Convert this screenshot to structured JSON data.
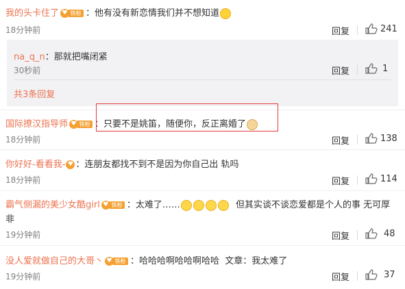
{
  "comments": [
    {
      "author": "我的头卡住了",
      "badge": "铁粉",
      "text": "：他有没有新恋情我们并不想知道",
      "emoji": "smiling-face-emoji",
      "time": "18分钟前",
      "reply_label": "回复",
      "likes": "241"
    },
    {
      "author": "国际撩汉指导师",
      "badge": "铁粉",
      "text": "：只要不是姚笛，随便你，反正离婚了",
      "emoji": "dog-face-emoji",
      "time": "18分钟前",
      "reply_label": "回复",
      "likes": "138"
    },
    {
      "author": "你好好-看看我-",
      "text": "：连朋友都找不到不是因为你自己出 轨吗",
      "time": "18分钟前",
      "reply_label": "回复",
      "likes": "114"
    },
    {
      "author": "霸气侧漏的美少女酷girl",
      "badge": "铁粉",
      "text_before": "：太难了……",
      "emoji": "crying-laughing-emoji",
      "text_after": "但其实谈不谈恋爱都是个人的事 无可厚",
      "text_wrap": "非",
      "time": "19分钟前",
      "reply_label": "回复",
      "likes": "48"
    },
    {
      "author": "没人爱就做自己的大哥丶",
      "badge": "铁粉",
      "text": "：哈哈哈啊哈哈啊哈哈  文章：我太难了",
      "time": "19分钟前",
      "reply_label": "回复",
      "likes": "37"
    }
  ],
  "sub_reply": {
    "author": "na_q_n",
    "text": "：那就把嘴闭紧",
    "time": "30秒前",
    "reply_label": "回复",
    "likes": "1"
  },
  "more_replies": "共3条回复",
  "colors": {
    "author": "#eb7350",
    "badge": "#f4a032",
    "highlight_box": "#e53b3b"
  }
}
